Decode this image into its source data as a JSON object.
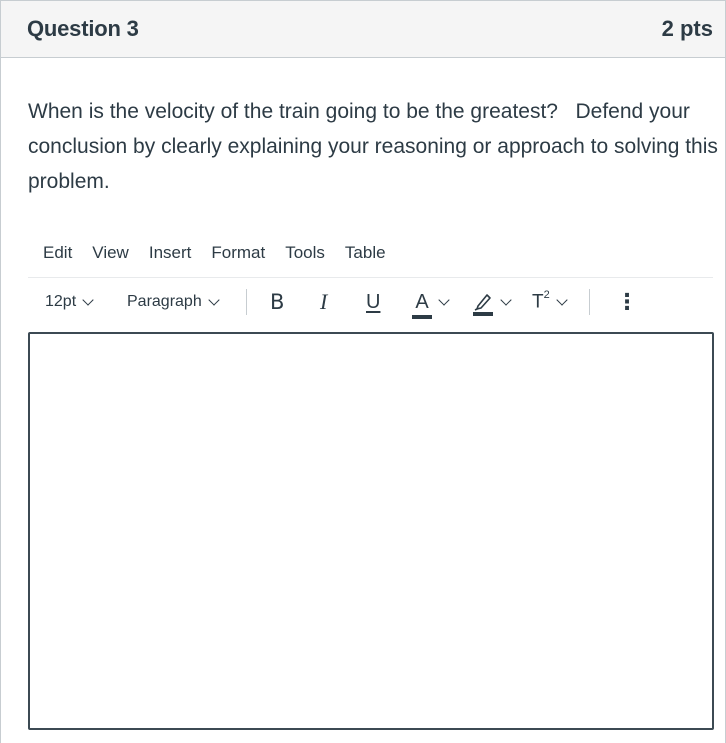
{
  "question": {
    "title": "Question 3",
    "points": "2 pts",
    "text": "When is the velocity of the train going to be the greatest?   Defend your conclusion by clearly explaining your reasoning or approach to solving this problem."
  },
  "menubar": {
    "items": [
      "Edit",
      "View",
      "Insert",
      "Format",
      "Tools",
      "Table"
    ]
  },
  "toolbar": {
    "font_size": "12pt",
    "block_format": "Paragraph",
    "bold": "B",
    "italic": "I",
    "underline": "U",
    "text_color": "A",
    "superscript_base": "T",
    "superscript_exp": "2",
    "more": "⋮"
  },
  "colors": {
    "header_bg": "#f5f5f5",
    "text": "#2d3b45",
    "border": "#c7cdd1",
    "editor_border": "#3c4a53"
  },
  "editor": {
    "value": ""
  }
}
